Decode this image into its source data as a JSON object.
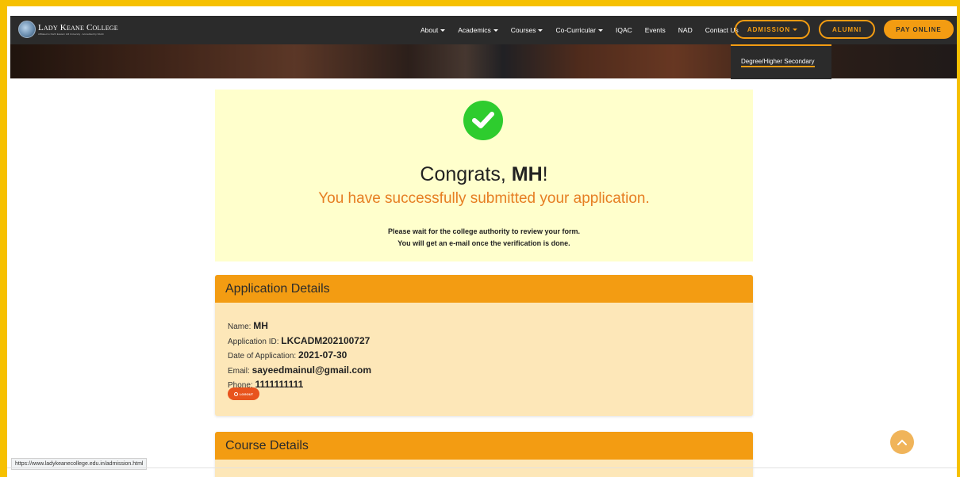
{
  "brand": {
    "name": "Lady Keane College",
    "tagline": "Affiliated to North Eastern Hill University · Accredited by NAAC"
  },
  "nav": {
    "items": [
      {
        "label": "About",
        "has_caret": true
      },
      {
        "label": "Academics",
        "has_caret": true
      },
      {
        "label": "Courses",
        "has_caret": true
      },
      {
        "label": "Co-Curricular",
        "has_caret": true
      },
      {
        "label": "IQAC",
        "has_caret": false
      },
      {
        "label": "Events",
        "has_caret": false
      },
      {
        "label": "NAD",
        "has_caret": false
      },
      {
        "label": "Contact Us",
        "has_caret": false
      }
    ],
    "admission_label": "ADMISSION",
    "alumni_label": "ALUMNI",
    "pay_label": "PAY ONLINE",
    "dropdown_item": "Degree/Higher Secondary"
  },
  "congrats": {
    "prefix": "Congrats, ",
    "name": "MH",
    "suffix": "!",
    "message": "You have successfully submitted your application.",
    "note_line1": "Please wait for the college authority to review your form.",
    "note_line2": "You will get an e-mail once the verification is done."
  },
  "application": {
    "header": "Application Details",
    "name_label": "Name:",
    "name_value": "MH",
    "id_label": "Application ID:",
    "id_value": "LKCADM202100727",
    "date_label": "Date of Application:",
    "date_value": "2021-07-30",
    "email_label": "Email:",
    "email_value": "sayeedmainul@gmail.com",
    "phone_label": "Phone:",
    "phone_value": "1111111111",
    "logout_label": "LOGOUT"
  },
  "course": {
    "header": "Course Details"
  },
  "status_bar": {
    "url": "https://www.ladykeanecollege.edu.in/admission.html"
  },
  "colors": {
    "accent": "#f39c12",
    "frame": "#f6c000",
    "success": "#2ecc2e",
    "navbar": "#2b2b2b"
  },
  "icons": [
    "check-icon",
    "chevron-up-icon",
    "power-icon",
    "caret-down-icon"
  ]
}
